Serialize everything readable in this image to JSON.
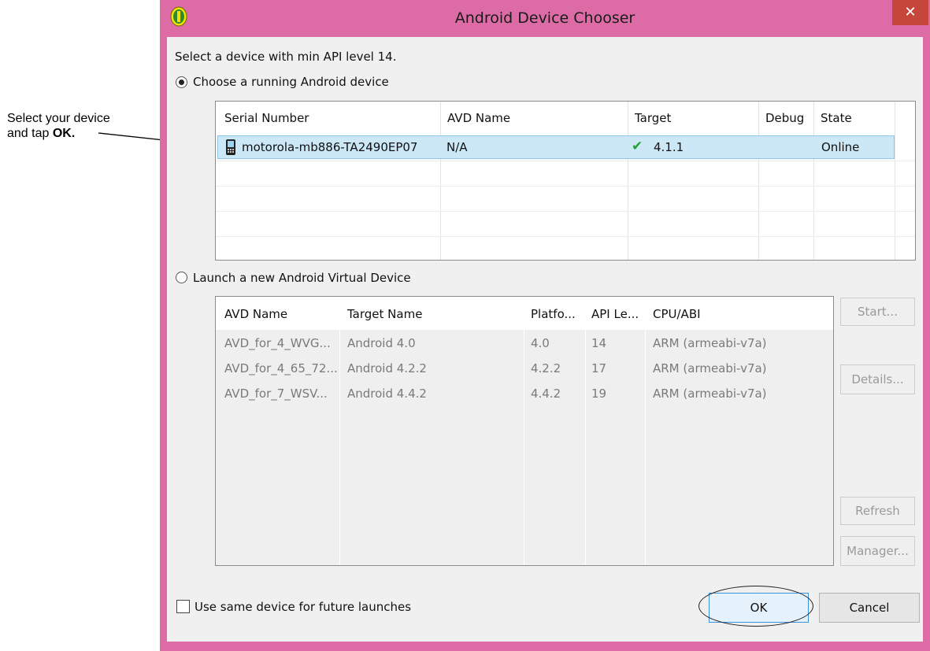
{
  "annotation": {
    "line1": "Select your device",
    "line2_prefix": "and tap ",
    "line2_bold": "OK."
  },
  "window": {
    "title": "Android Device Chooser",
    "close_glyph": "✕"
  },
  "prompt": "Select a device with min API level 14.",
  "running": {
    "radio_label": "Choose a running Android device",
    "columns": [
      "Serial Number",
      "AVD Name",
      "Target",
      "Debug",
      "State"
    ],
    "rows": [
      {
        "serial": "motorola-mb886-TA2490EP07",
        "avd": "N/A",
        "target": "4.1.1",
        "debug": "",
        "state": "Online"
      }
    ]
  },
  "virtual": {
    "radio_label": "Launch a new Android Virtual Device",
    "columns": [
      "AVD Name",
      "Target Name",
      "Platfo...",
      "API Le...",
      "CPU/ABI"
    ],
    "rows": [
      [
        "AVD_for_4_WVG...",
        "Android 4.0",
        "4.0",
        "14",
        "ARM (armeabi-v7a)"
      ],
      [
        "AVD_for_4_65_72...",
        "Android 4.2.2",
        "4.2.2",
        "17",
        "ARM (armeabi-v7a)"
      ],
      [
        "AVD_for_7_WSV...",
        "Android 4.4.2",
        "4.4.2",
        "19",
        "ARM (armeabi-v7a)"
      ]
    ],
    "buttons": {
      "start": "Start...",
      "details": "Details...",
      "refresh": "Refresh",
      "manager": "Manager..."
    }
  },
  "footer": {
    "checkbox_label": "Use same device for future launches",
    "ok": "OK",
    "cancel": "Cancel"
  }
}
